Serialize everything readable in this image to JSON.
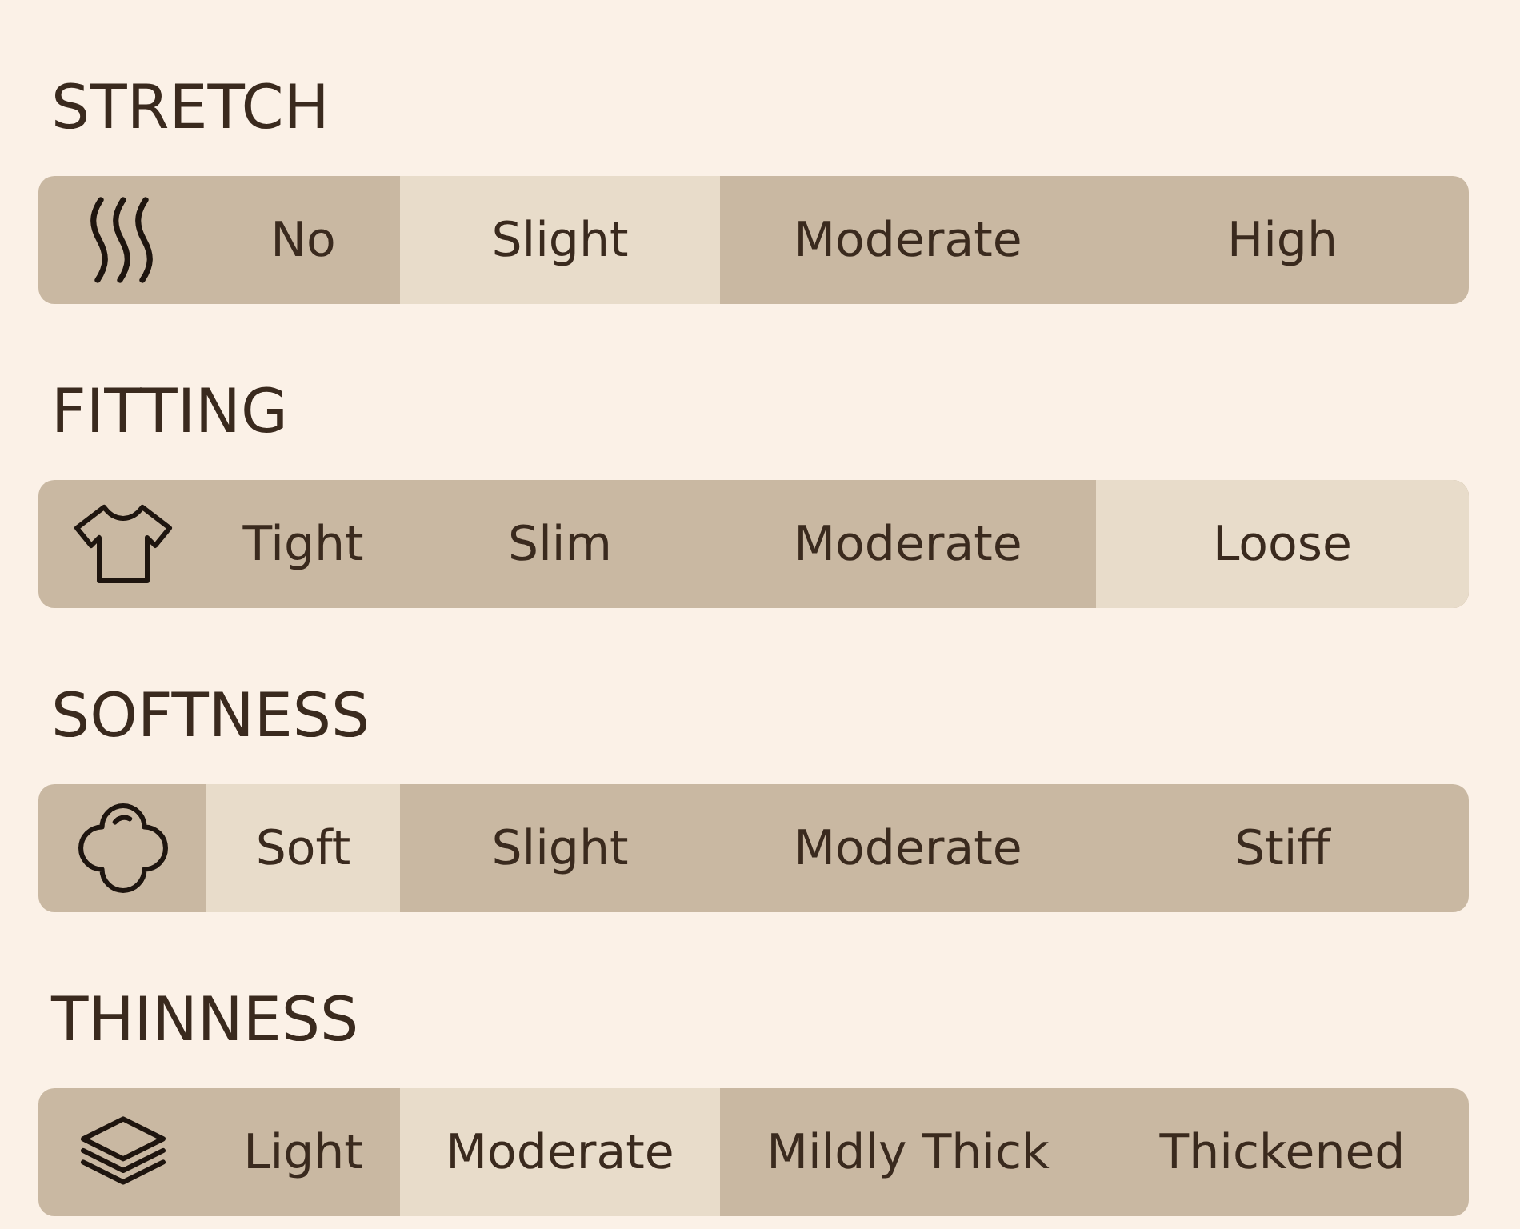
{
  "sections": [
    {
      "title": "STRETCH",
      "options": [
        {
          "label": "No",
          "selected": false
        },
        {
          "label": "Slight",
          "selected": true
        },
        {
          "label": "Moderate",
          "selected": false
        },
        {
          "label": "High",
          "selected": false
        }
      ]
    },
    {
      "title": "FITTING",
      "options": [
        {
          "label": "Tight",
          "selected": false
        },
        {
          "label": "Slim",
          "selected": false
        },
        {
          "label": "Moderate",
          "selected": false
        },
        {
          "label": "Loose",
          "selected": true
        }
      ]
    },
    {
      "title": "SOFTNESS",
      "options": [
        {
          "label": "Soft",
          "selected": true
        },
        {
          "label": "Slight",
          "selected": false
        },
        {
          "label": "Moderate",
          "selected": false
        },
        {
          "label": "Stiff",
          "selected": false
        }
      ]
    },
    {
      "title": "THINNESS",
      "options": [
        {
          "label": "Light",
          "selected": false
        },
        {
          "label": "Moderate",
          "selected": true
        },
        {
          "label": "Mildly Thick",
          "selected": false
        },
        {
          "label": "Thickened",
          "selected": false
        }
      ]
    }
  ]
}
